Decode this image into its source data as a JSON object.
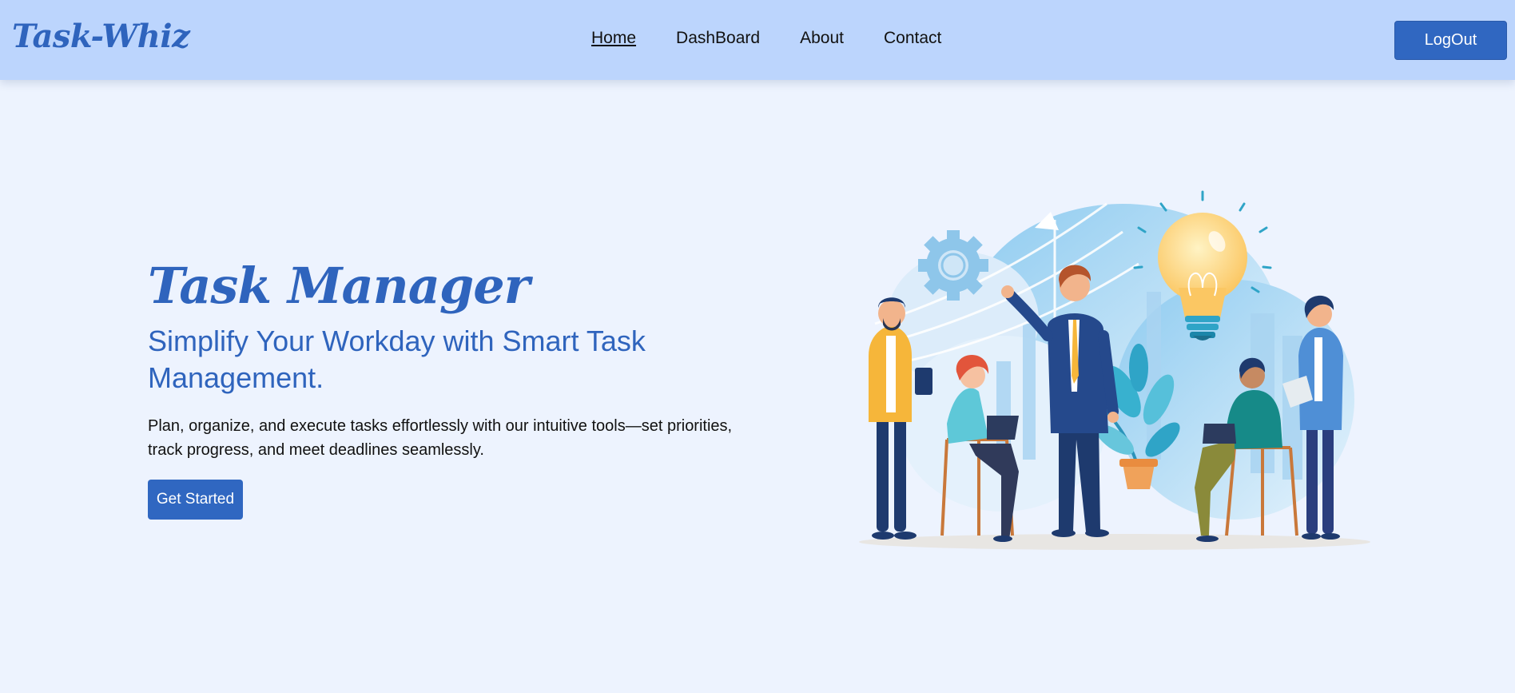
{
  "brand": {
    "logo_text": "Task-Whiz"
  },
  "nav": {
    "links": [
      {
        "label": "Home",
        "active": true
      },
      {
        "label": "DashBoard",
        "active": false
      },
      {
        "label": "About",
        "active": false
      },
      {
        "label": "Contact",
        "active": false
      }
    ],
    "logout_label": "LogOut"
  },
  "hero": {
    "title": "Task Manager",
    "subtitle": "Simplify Your Workday with Smart Task Management.",
    "description": "Plan, organize, and execute tasks effortlessly with our intuitive tools—set priorities, track progress, and meet deadlines seamlessly.",
    "cta_label": "Get Started"
  },
  "colors": {
    "navbar_bg": "#bcd5fd",
    "page_bg": "#edf3fe",
    "accent": "#2f64bd",
    "button_bg": "#3067c1"
  }
}
